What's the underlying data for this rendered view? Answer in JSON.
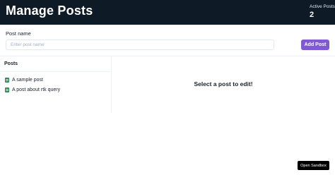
{
  "header": {
    "title": "Manage Posts",
    "stat_label": "Active Posts",
    "stat_value": "2"
  },
  "form": {
    "label": "Post name",
    "placeholder": "Enter post name",
    "value": "",
    "add_button": "Add Post"
  },
  "sidebar": {
    "heading": "Posts",
    "items": [
      {
        "label": "A sample post",
        "icon": "document-icon"
      },
      {
        "label": "A post about rtk query",
        "icon": "document-icon"
      }
    ]
  },
  "main": {
    "message": "Select a post to edit!"
  },
  "footer": {
    "sandbox_button": "Open Sandbox"
  },
  "colors": {
    "header_bg": "#0e1a26",
    "accent": "#805ad5",
    "icon": "#2f855a"
  }
}
